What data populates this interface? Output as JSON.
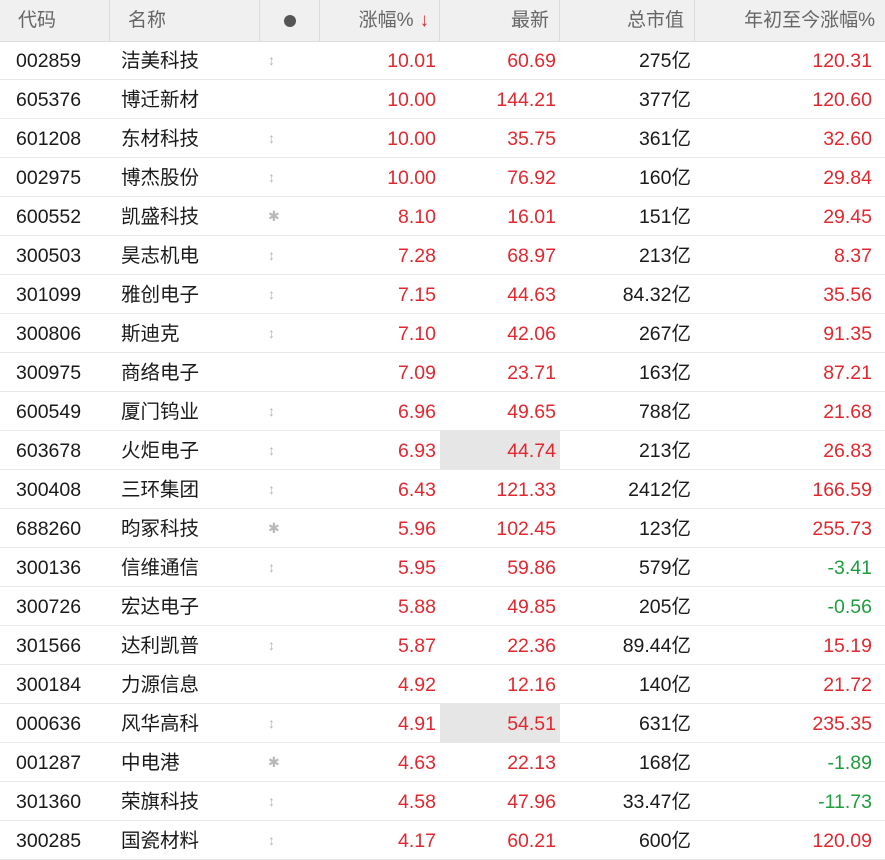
{
  "header": {
    "code": "代码",
    "name": "名称",
    "change_pct": "涨幅%",
    "sort_indicator": "↓",
    "latest": "最新",
    "market_cap": "总市值",
    "ytd_change": "年初至今涨幅%"
  },
  "colors": {
    "up": "#e3272f",
    "down": "#1e9e3e",
    "highlight": "#e6e6e6"
  },
  "rows": [
    {
      "code": "002859",
      "name": "洁美科技",
      "icon": "↕",
      "change_pct": "10.01",
      "latest": "60.69",
      "market_cap": "275亿",
      "ytd": "120.31",
      "ytd_dir": "up"
    },
    {
      "code": "605376",
      "name": "博迁新材",
      "icon": "",
      "change_pct": "10.00",
      "latest": "144.21",
      "market_cap": "377亿",
      "ytd": "120.60",
      "ytd_dir": "up"
    },
    {
      "code": "601208",
      "name": "东材科技",
      "icon": "↕",
      "change_pct": "10.00",
      "latest": "35.75",
      "market_cap": "361亿",
      "ytd": "32.60",
      "ytd_dir": "up"
    },
    {
      "code": "002975",
      "name": "博杰股份",
      "icon": "↕",
      "change_pct": "10.00",
      "latest": "76.92",
      "market_cap": "160亿",
      "ytd": "29.84",
      "ytd_dir": "up"
    },
    {
      "code": "600552",
      "name": "凯盛科技",
      "icon": "✱",
      "change_pct": "8.10",
      "latest": "16.01",
      "market_cap": "151亿",
      "ytd": "29.45",
      "ytd_dir": "up"
    },
    {
      "code": "300503",
      "name": "昊志机电",
      "icon": "↕",
      "change_pct": "7.28",
      "latest": "68.97",
      "market_cap": "213亿",
      "ytd": "8.37",
      "ytd_dir": "up"
    },
    {
      "code": "301099",
      "name": "雅创电子",
      "icon": "↕",
      "change_pct": "7.15",
      "latest": "44.63",
      "market_cap": "84.32亿",
      "ytd": "35.56",
      "ytd_dir": "up"
    },
    {
      "code": "300806",
      "name": "斯迪克",
      "icon": "↕",
      "change_pct": "7.10",
      "latest": "42.06",
      "market_cap": "267亿",
      "ytd": "91.35",
      "ytd_dir": "up"
    },
    {
      "code": "300975",
      "name": "商络电子",
      "icon": "",
      "change_pct": "7.09",
      "latest": "23.71",
      "market_cap": "163亿",
      "ytd": "87.21",
      "ytd_dir": "up"
    },
    {
      "code": "600549",
      "name": "厦门钨业",
      "icon": "↕",
      "change_pct": "6.96",
      "latest": "49.65",
      "market_cap": "788亿",
      "ytd": "21.68",
      "ytd_dir": "up"
    },
    {
      "code": "603678",
      "name": "火炬电子",
      "icon": "↕",
      "change_pct": "6.93",
      "latest": "44.74",
      "market_cap": "213亿",
      "ytd": "26.83",
      "ytd_dir": "up",
      "highlight": true
    },
    {
      "code": "300408",
      "name": "三环集团",
      "icon": "↕",
      "change_pct": "6.43",
      "latest": "121.33",
      "market_cap": "2412亿",
      "ytd": "166.59",
      "ytd_dir": "up"
    },
    {
      "code": "688260",
      "name": "昀冢科技",
      "icon": "✱",
      "change_pct": "5.96",
      "latest": "102.45",
      "market_cap": "123亿",
      "ytd": "255.73",
      "ytd_dir": "up"
    },
    {
      "code": "300136",
      "name": "信维通信",
      "icon": "↕",
      "change_pct": "5.95",
      "latest": "59.86",
      "market_cap": "579亿",
      "ytd": "-3.41",
      "ytd_dir": "down"
    },
    {
      "code": "300726",
      "name": "宏达电子",
      "icon": "",
      "change_pct": "5.88",
      "latest": "49.85",
      "market_cap": "205亿",
      "ytd": "-0.56",
      "ytd_dir": "down"
    },
    {
      "code": "301566",
      "name": "达利凯普",
      "icon": "↕",
      "change_pct": "5.87",
      "latest": "22.36",
      "market_cap": "89.44亿",
      "ytd": "15.19",
      "ytd_dir": "up"
    },
    {
      "code": "300184",
      "name": "力源信息",
      "icon": "",
      "change_pct": "4.92",
      "latest": "12.16",
      "market_cap": "140亿",
      "ytd": "21.72",
      "ytd_dir": "up"
    },
    {
      "code": "000636",
      "name": "风华高科",
      "icon": "↕",
      "change_pct": "4.91",
      "latest": "54.51",
      "market_cap": "631亿",
      "ytd": "235.35",
      "ytd_dir": "up",
      "highlight": true
    },
    {
      "code": "001287",
      "name": "中电港",
      "icon": "✱",
      "change_pct": "4.63",
      "latest": "22.13",
      "market_cap": "168亿",
      "ytd": "-1.89",
      "ytd_dir": "down"
    },
    {
      "code": "301360",
      "name": "荣旗科技",
      "icon": "↕",
      "change_pct": "4.58",
      "latest": "47.96",
      "market_cap": "33.47亿",
      "ytd": "-11.73",
      "ytd_dir": "down"
    },
    {
      "code": "300285",
      "name": "国瓷材料",
      "icon": "↕",
      "change_pct": "4.17",
      "latest": "60.21",
      "market_cap": "600亿",
      "ytd": "120.09",
      "ytd_dir": "up"
    }
  ]
}
